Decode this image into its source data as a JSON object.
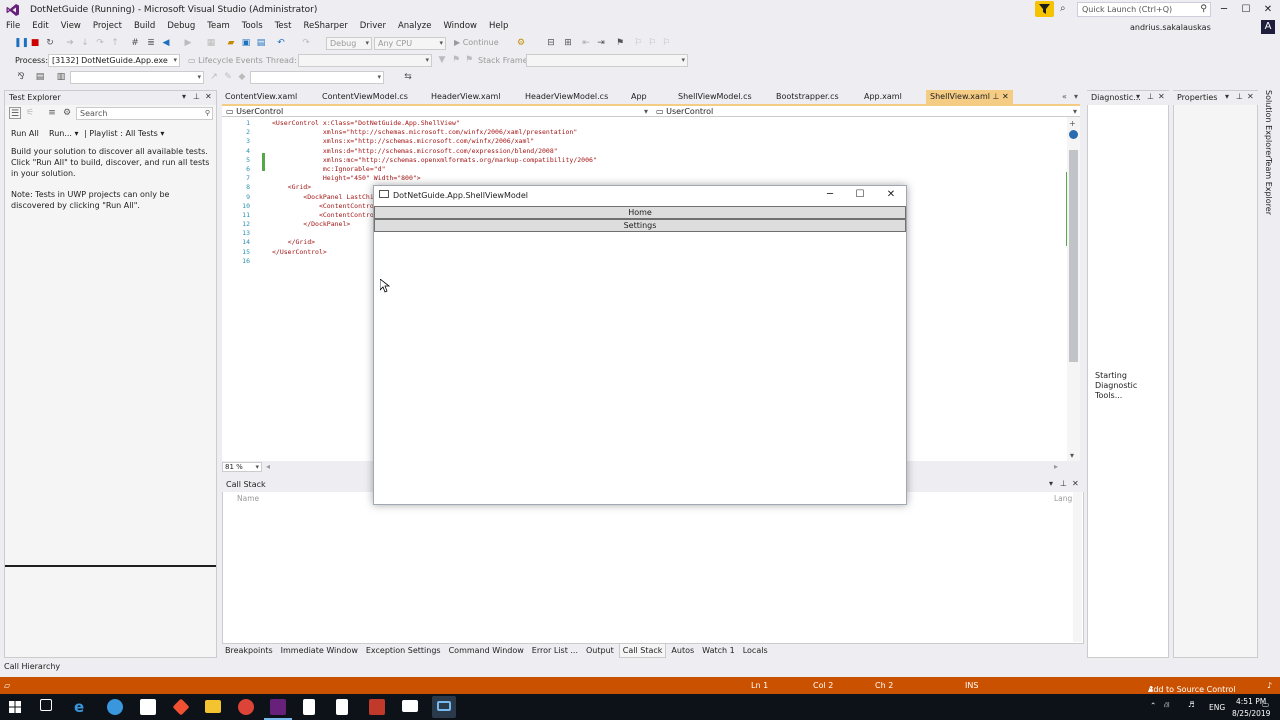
{
  "window": {
    "title": "DotNetGuide (Running) - Microsoft Visual Studio  (Administrator)",
    "minimize": "─",
    "maximize": "☐",
    "close": "✕"
  },
  "quick_launch": {
    "placeholder": "Quick Launch (Ctrl+Q)"
  },
  "user": {
    "name": "andrius.sakalauskas",
    "initial": "A"
  },
  "menu": [
    "File",
    "Edit",
    "View",
    "Project",
    "Build",
    "Debug",
    "Team",
    "Tools",
    "Test",
    "ReSharper",
    "Driver",
    "Analyze",
    "Window",
    "Help"
  ],
  "toolbar": {
    "config": "Debug",
    "platform": "Any CPU",
    "continue_label": "Continue"
  },
  "debug_location": {
    "process_label": "Process:",
    "process_value": "[3132] DotNetGuide.App.exe",
    "lifecycle_label": "Lifecycle Events",
    "thread_label": "Thread:",
    "stack_frame_label": "Stack Frame:"
  },
  "test_explorer": {
    "title": "Test Explorer",
    "search_placeholder": "Search",
    "run_all": "Run All",
    "run": "Run...",
    "playlist": "Playlist : All Tests",
    "message": "Build your solution to discover all available tests. Click \"Run All\" to build, discover, and run all tests in your solution.",
    "note": "Note: Tests in UWP projects can only be discovered by clicking \"Run All\"."
  },
  "doc_tabs": [
    "ContentView.xaml",
    "ContentViewModel.cs",
    "HeaderView.xaml",
    "HeaderViewModel.cs",
    "App",
    "ShellViewModel.cs",
    "Bootstrapper.cs",
    "App.xaml",
    "ShellView.xaml"
  ],
  "nav_bar": {
    "left": "UserControl",
    "right": "UserControl"
  },
  "code": {
    "line_numbers": [
      "1",
      "2",
      "3",
      "4",
      "5",
      "6",
      "7",
      "8",
      "9",
      "10",
      "11",
      "12",
      "13",
      "14",
      "15",
      "16"
    ],
    "lines": [
      "<UserControl x:Class=\"DotNetGuide.App.ShellView\"",
      "             xmlns=\"http://schemas.microsoft.com/winfx/2006/xaml/presentation\"",
      "             xmlns:x=\"http://schemas.microsoft.com/winfx/2006/xaml\"",
      "             xmlns:d=\"http://schemas.microsoft.com/expression/blend/2008\"",
      "             xmlns:mc=\"http://schemas.openxmlformats.org/markup-compatibility/2006\"",
      "             mc:Ignorable=\"d\"",
      "             Height=\"450\" Width=\"800\">",
      "    <Grid>",
      "        <DockPanel LastChi",
      "            <ContentContro",
      "            <ContentContro",
      "        </DockPanel>",
      "",
      "    </Grid>",
      "</UserControl>",
      ""
    ]
  },
  "zoom": "81 %",
  "diagnostic": {
    "title": "Diagnostic...",
    "status": "Starting Diagnostic Tools..."
  },
  "properties": {
    "title": "Properties"
  },
  "side_tabs": [
    "Solution Explorer",
    "Team Explorer"
  ],
  "call_stack": {
    "title": "Call Stack",
    "col_name": "Name",
    "col_lang": "Lang"
  },
  "wpf_window": {
    "title": "DotNetGuide.App.ShellViewModel",
    "buttons": [
      "Home",
      "Settings"
    ],
    "minimize": "─",
    "maximize": "☐",
    "close": "✕"
  },
  "bottom_tabs": [
    "Breakpoints",
    "Immediate Window",
    "Exception Settings",
    "Command Window",
    "Error List ...",
    "Output",
    "Call Stack",
    "Autos",
    "Watch 1",
    "Locals"
  ],
  "call_hierarchy": "Call Hierarchy",
  "status": {
    "ln": "Ln 1",
    "col": "Col 2",
    "ch": "Ch 2",
    "ins": "INS",
    "source_control": "Add to Source Control"
  },
  "tray": {
    "lang": "ENG",
    "time": "4:51 PM",
    "date": "8/25/2019"
  },
  "colors": {
    "accent": "#ca5100",
    "selected_tab": "#f5cc84",
    "vs_purple": "#68217a"
  }
}
